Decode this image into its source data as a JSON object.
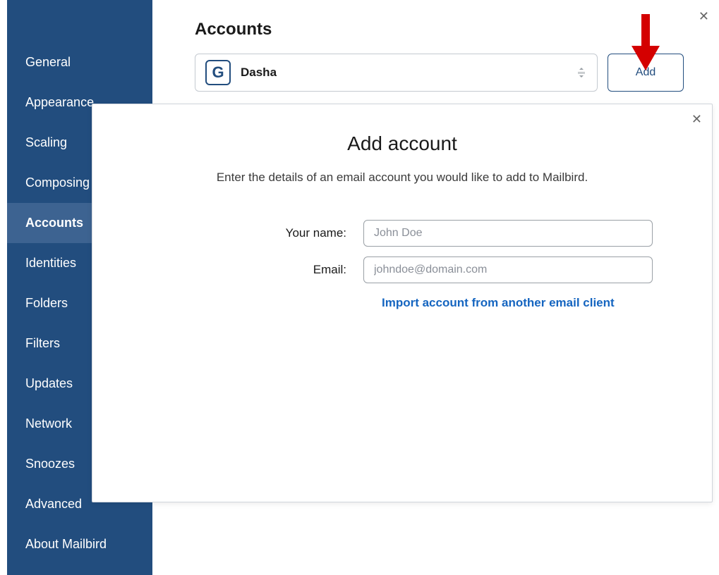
{
  "sidebar": {
    "items": [
      {
        "label": "General"
      },
      {
        "label": "Appearance"
      },
      {
        "label": "Scaling"
      },
      {
        "label": "Composing"
      },
      {
        "label": "Accounts",
        "active": true
      },
      {
        "label": "Identities"
      },
      {
        "label": "Folders"
      },
      {
        "label": "Filters"
      },
      {
        "label": "Updates"
      },
      {
        "label": "Network"
      },
      {
        "label": "Snoozes"
      },
      {
        "label": "Advanced"
      },
      {
        "label": "About Mailbird"
      }
    ]
  },
  "main": {
    "title": "Accounts",
    "account": {
      "avatar_letter": "G",
      "name": "Dasha"
    },
    "add_button": "Add"
  },
  "modal": {
    "title": "Add account",
    "subtitle": "Enter the details of an email account you would like to add to Mailbird.",
    "name_label": "Your name:",
    "name_placeholder": "John Doe",
    "email_label": "Email:",
    "email_placeholder": "johndoe@domain.com",
    "import_link": "Import account from another email client"
  }
}
